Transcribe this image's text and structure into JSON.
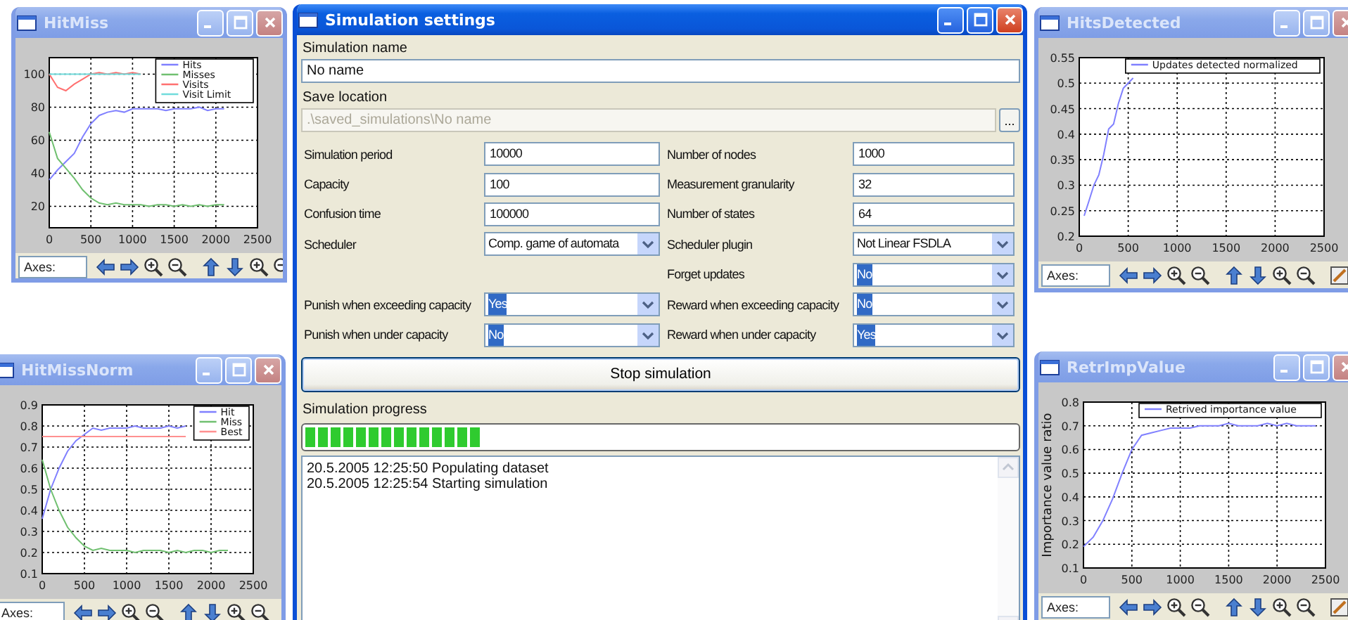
{
  "plot_windows": [
    {
      "title": "HitMiss",
      "active": false,
      "axes_field": "Axes:",
      "chart_data": {
        "type": "line",
        "grid": true,
        "legend": true,
        "x": [
          0,
          100,
          200,
          300,
          400,
          500,
          600,
          700,
          800,
          900,
          1000,
          1100,
          1200,
          1300,
          1400,
          1500,
          1600,
          1700,
          1800,
          1900,
          2000,
          2100
        ],
        "xlim": [
          0,
          2500
        ],
        "ylim": [
          7,
          110
        ],
        "xticks": [
          0,
          500,
          1000,
          1500,
          2000,
          2500
        ],
        "yticks": [
          20,
          40,
          60,
          80,
          100
        ],
        "series": [
          {
            "name": "Hits",
            "color": "#8080ff",
            "values": [
              36,
              42,
              47,
              52,
              62,
              70,
              75,
              77,
              78,
              77,
              79,
              79,
              79,
              79,
              78,
              79,
              79,
              79,
              80,
              78,
              79,
              79
            ]
          },
          {
            "name": "Misses",
            "color": "#70c070",
            "values": [
              65,
              49,
              43,
              37,
              30,
              25,
              22,
              21,
              22,
              21,
              21,
              21,
              20,
              21,
              21,
              20,
              21,
              20,
              21,
              20,
              21,
              21
            ]
          },
          {
            "name": "Visits",
            "color": "#ff7070",
            "values": [
              100,
              92,
              90,
              94,
              97,
              100,
              101,
              100,
              101,
              100,
              101,
              100,
              null,
              null,
              null,
              null,
              null,
              null,
              null,
              null,
              null,
              null
            ]
          },
          {
            "name": "Visit Limit",
            "color": "#70dcdc",
            "values": [
              100,
              100,
              100,
              100,
              100,
              100,
              100,
              100,
              100,
              100,
              100,
              100,
              null,
              null,
              null,
              null,
              null,
              null,
              null,
              null,
              null,
              null
            ]
          }
        ]
      }
    },
    {
      "title": "HitMissNorm",
      "active": false,
      "axes_field": "Axes:",
      "chart_data": {
        "type": "line",
        "grid": true,
        "legend": true,
        "x": [
          0,
          100,
          200,
          300,
          400,
          500,
          600,
          700,
          800,
          900,
          1000,
          1100,
          1200,
          1300,
          1400,
          1500,
          1600,
          1700,
          1800,
          1900,
          2000,
          2100,
          2200
        ],
        "xlim": [
          0,
          2500
        ],
        "ylim": [
          0.1,
          0.9
        ],
        "xticks": [
          0,
          500,
          1000,
          1500,
          2000,
          2500
        ],
        "yticks": [
          0.1,
          0.2,
          0.3,
          0.4,
          0.5,
          0.6,
          0.7,
          0.8,
          0.9
        ],
        "series": [
          {
            "name": "Hit",
            "color": "#8080ff",
            "values": [
              0.36,
              0.5,
              0.6,
              0.68,
              0.73,
              0.76,
              0.79,
              0.78,
              0.79,
              0.79,
              0.79,
              0.8,
              0.79,
              0.79,
              0.79,
              0.8,
              0.79,
              0.8,
              null,
              null,
              null,
              null,
              null
            ]
          },
          {
            "name": "Miss",
            "color": "#70c070",
            "values": [
              0.64,
              0.5,
              0.4,
              0.32,
              0.27,
              0.23,
              0.21,
              0.22,
              0.21,
              0.21,
              0.21,
              0.2,
              0.21,
              0.21,
              0.21,
              0.2,
              0.21,
              0.2,
              0.21,
              0.21,
              0.2,
              0.21,
              0.21
            ]
          },
          {
            "name": "Best",
            "color": "#ff9090",
            "values": [
              0.75,
              0.75,
              0.75,
              0.75,
              0.75,
              0.75,
              0.75,
              0.75,
              0.75,
              0.75,
              0.75,
              0.75,
              0.75,
              0.75,
              0.75,
              0.75,
              0.75,
              0.75,
              null,
              null,
              null,
              null,
              null
            ]
          }
        ]
      }
    },
    {
      "title": "HitsDetected",
      "active": false,
      "axes_field": "Axes:",
      "chart_data": {
        "type": "line",
        "grid": true,
        "legend": true,
        "x": [
          50,
          100,
          150,
          200,
          250,
          300,
          350,
          400,
          450,
          500,
          550
        ],
        "xlim": [
          0,
          2500
        ],
        "ylim": [
          0.2,
          0.55
        ],
        "xticks": [
          0,
          500,
          1000,
          1500,
          2000,
          2500
        ],
        "yticks": [
          0.2,
          0.25,
          0.3,
          0.35,
          0.4,
          0.45,
          0.5,
          0.55
        ],
        "series": [
          {
            "name": "Updates detected normalized",
            "color": "#8080ff",
            "values": [
              0.24,
              0.27,
              0.3,
              0.32,
              0.36,
              0.41,
              0.42,
              0.46,
              0.49,
              0.5,
              0.51
            ]
          }
        ]
      }
    },
    {
      "title": "RetrImpValue",
      "active": false,
      "axes_field": "Axes:",
      "chart_data": {
        "type": "line",
        "grid": true,
        "legend": true,
        "ylabel": "Importance value ratio",
        "x": [
          0,
          100,
          200,
          300,
          400,
          500,
          600,
          700,
          800,
          900,
          1000,
          1100,
          1200,
          1300,
          1400,
          1500,
          1600,
          1700,
          1800,
          1900,
          2000,
          2100,
          2200,
          2300,
          2400
        ],
        "xlim": [
          0,
          2500
        ],
        "ylim": [
          0.1,
          0.8
        ],
        "xticks": [
          0,
          500,
          1000,
          1500,
          2000,
          2500
        ],
        "yticks": [
          0.1,
          0.2,
          0.3,
          0.4,
          0.5,
          0.6,
          0.7,
          0.8
        ],
        "series": [
          {
            "name": "Retrived importance value",
            "color": "#8080ff",
            "values": [
              0.19,
              0.23,
              0.3,
              0.39,
              0.5,
              0.6,
              0.66,
              0.67,
              0.68,
              0.69,
              0.69,
              0.69,
              0.7,
              0.7,
              0.7,
              0.71,
              0.7,
              0.7,
              0.7,
              0.71,
              0.7,
              0.71,
              0.7,
              0.7,
              0.7
            ]
          }
        ]
      }
    }
  ],
  "settings": {
    "title": "Simulation settings",
    "active": true,
    "name_label": "Simulation name",
    "name_value": "No name",
    "location_label": "Save location",
    "location_value": ".\\saved_simulations\\No name",
    "location_disabled": true,
    "browse_button": "...",
    "rows": [
      {
        "left": {
          "label": "Simulation period",
          "kind": "text",
          "value": "10000"
        },
        "right": {
          "label": "Number of nodes",
          "kind": "text",
          "value": "1000"
        }
      },
      {
        "left": {
          "label": "Capacity",
          "kind": "text",
          "value": "100"
        },
        "right": {
          "label": "Measurement granularity",
          "kind": "text",
          "value": "32"
        }
      },
      {
        "left": {
          "label": "Confusion time",
          "kind": "text",
          "value": "100000"
        },
        "right": {
          "label": "Number of states",
          "kind": "text",
          "value": "64"
        }
      },
      {
        "left": {
          "label": "Scheduler",
          "kind": "select",
          "value": "Comp. game of automata",
          "highlighted": false
        },
        "right": {
          "label": "Scheduler plugin",
          "kind": "select",
          "value": "Not Linear FSDLA",
          "highlighted": false
        }
      },
      {
        "right": {
          "label": "Forget updates",
          "kind": "select",
          "value": "No",
          "highlighted": true
        }
      },
      {
        "left": {
          "label": "Punish when exceeding capacity",
          "kind": "select",
          "value": "Yes",
          "highlighted": true
        },
        "right": {
          "label": "Reward when exceeding capacity",
          "kind": "select",
          "value": "No",
          "highlighted": true
        }
      },
      {
        "left": {
          "label": "Punish when under capacity",
          "kind": "select",
          "value": "No",
          "highlighted": true
        },
        "right": {
          "label": "Reward when under capacity",
          "kind": "select",
          "value": "Yes",
          "highlighted": true
        }
      }
    ],
    "stop_button": "Stop simulation",
    "progress_label": "Simulation progress",
    "progress": {
      "level": 0.25
    },
    "log": [
      "20.5.2005 12:25:50 Populating dataset",
      "20.5.2005 12:25:54 Starting simulation"
    ]
  }
}
